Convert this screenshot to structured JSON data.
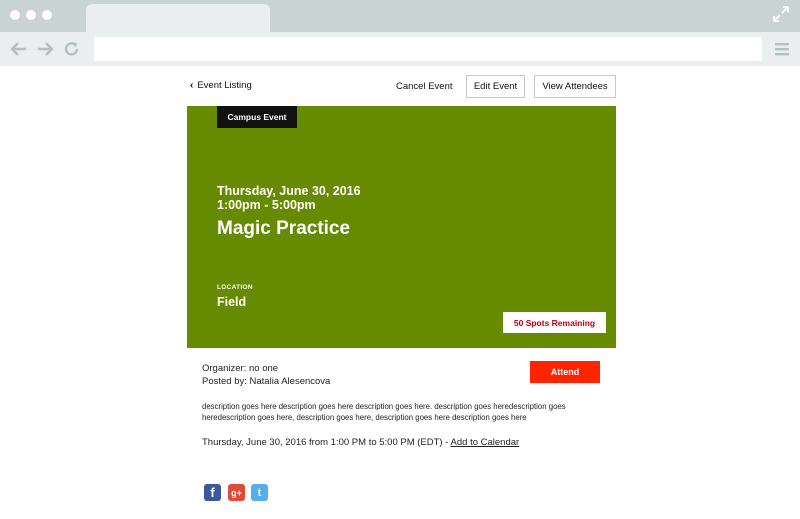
{
  "header": {
    "back_label": "Event Listing",
    "cancel_label": "Cancel Event",
    "edit_label": "Edit Event",
    "attendees_label": "View Attendees"
  },
  "event": {
    "category": "Campus Event",
    "date": "Thursday, June 30, 2016",
    "time": "1:00pm - 5:00pm",
    "title": "Magic Practice",
    "location_label": "LOCATION",
    "location": "Field",
    "spots_remaining": "50 Spots Remaining",
    "organizer": "Organizer: no one",
    "posted_by": "Posted by: Natalia Alesencova",
    "attend_label": "Attend",
    "description": "description goes here description goes here description goes here. description goes heredescription goes heredescription goes here, description goes here, description goes here description goes here",
    "datetime_text": "Thursday, June 30, 2016 from 1:00 PM to 5:00 PM (EDT) -",
    "add_to_calendar": "Add to Calendar"
  },
  "social": {
    "facebook_glyph": "f",
    "google_glyph": "g+",
    "twitter_glyph": "t"
  },
  "colors": {
    "hero_green": "#668a00",
    "attend_red": "#ff2400",
    "spots_red": "#b3001b",
    "facebook": "#3b5998",
    "google": "#dd4b39",
    "twitter": "#55acee"
  },
  "icons": {
    "back": "chevron-left-icon",
    "nav_back": "arrow-left-icon",
    "nav_forward": "arrow-right-icon",
    "reload": "reload-icon",
    "menu": "hamburger-menu-icon",
    "expand": "expand-icon"
  }
}
